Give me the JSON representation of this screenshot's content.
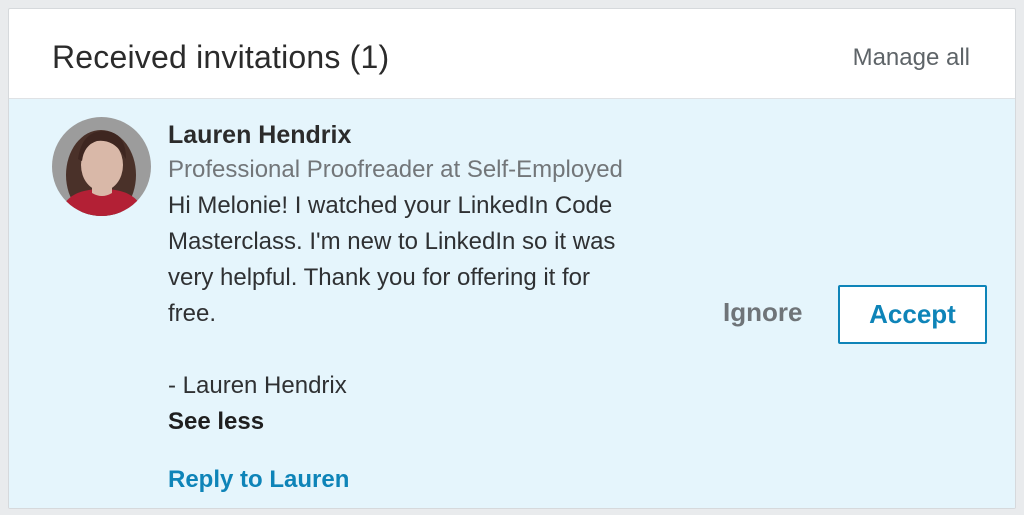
{
  "header": {
    "title": "Received invitations (1)",
    "manage_all": "Manage all"
  },
  "invitation": {
    "name": "Lauren Hendrix",
    "headline": "Professional Proofreader at Self-Employed",
    "message": "Hi Melonie! I watched your LinkedIn Code\nMasterclass. I'm new to LinkedIn so it was\nvery helpful. Thank you for offering it for\nfree.\n\n- Lauren Hendrix",
    "see_less": "See less",
    "reply": "Reply to Lauren",
    "ignore": "Ignore",
    "accept": "Accept",
    "avatar_icon": "profile-photo"
  },
  "colors": {
    "accent": "#0e84b8",
    "highlight_bg": "#e5f5fc"
  }
}
